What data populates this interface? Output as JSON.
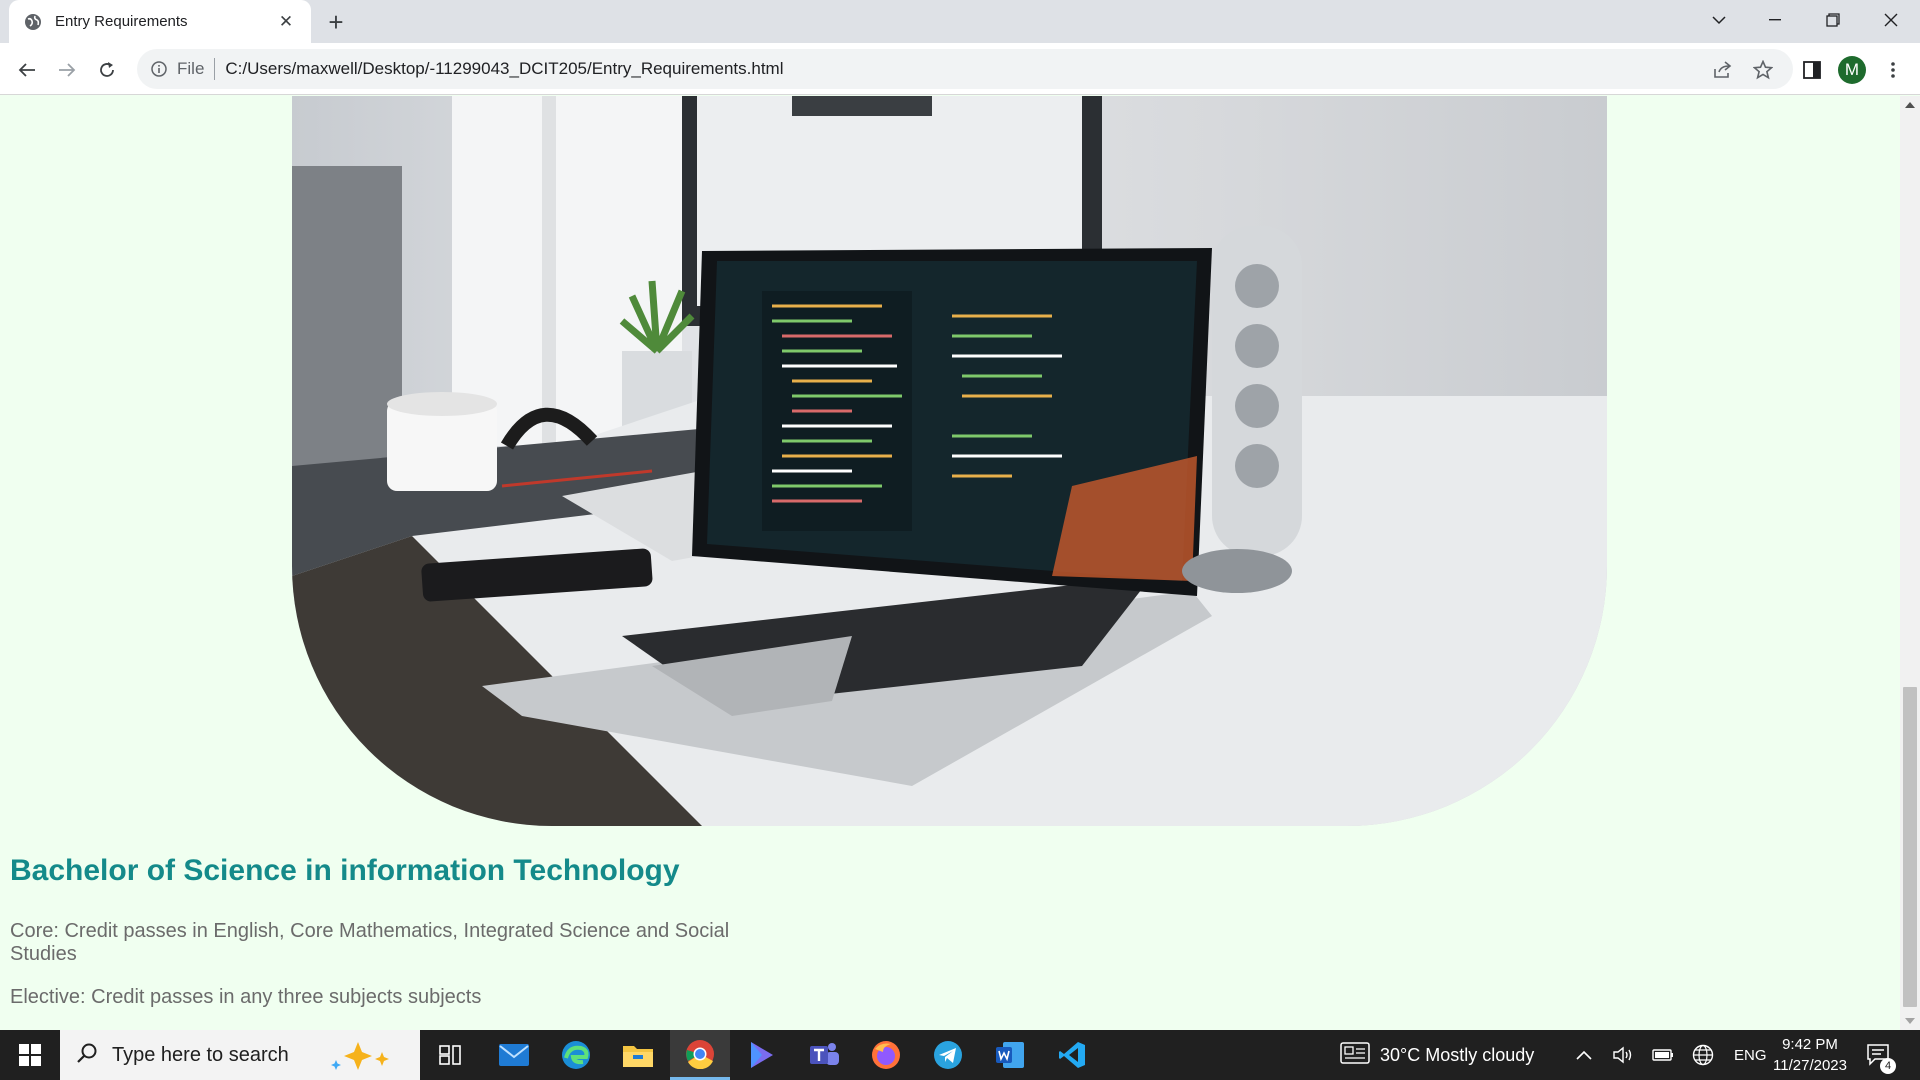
{
  "browser": {
    "tab_title": "Entry Requirements",
    "omnibox_scheme": "File",
    "url": "C:/Users/maxwell/Desktop/-11299043_DCIT205/Entry_Requirements.html",
    "profile_initial": "M"
  },
  "page": {
    "heading": "Bachelor of Science in information Technology",
    "core": "Core: Credit passes in English, Core Mathematics, Integrated Science and Social Studies",
    "elective": "Elective: Credit passes in any three subjects subjects"
  },
  "taskbar": {
    "search_placeholder": "Type here to search",
    "weather": "30°C  Mostly cloudy",
    "language": "ENG",
    "time": "9:42 PM",
    "date": "11/27/2023",
    "notification_count": "4"
  },
  "colors": {
    "page_background": "#f0fff0",
    "heading": "#148a8a",
    "body_text": "#6b6b6b"
  }
}
